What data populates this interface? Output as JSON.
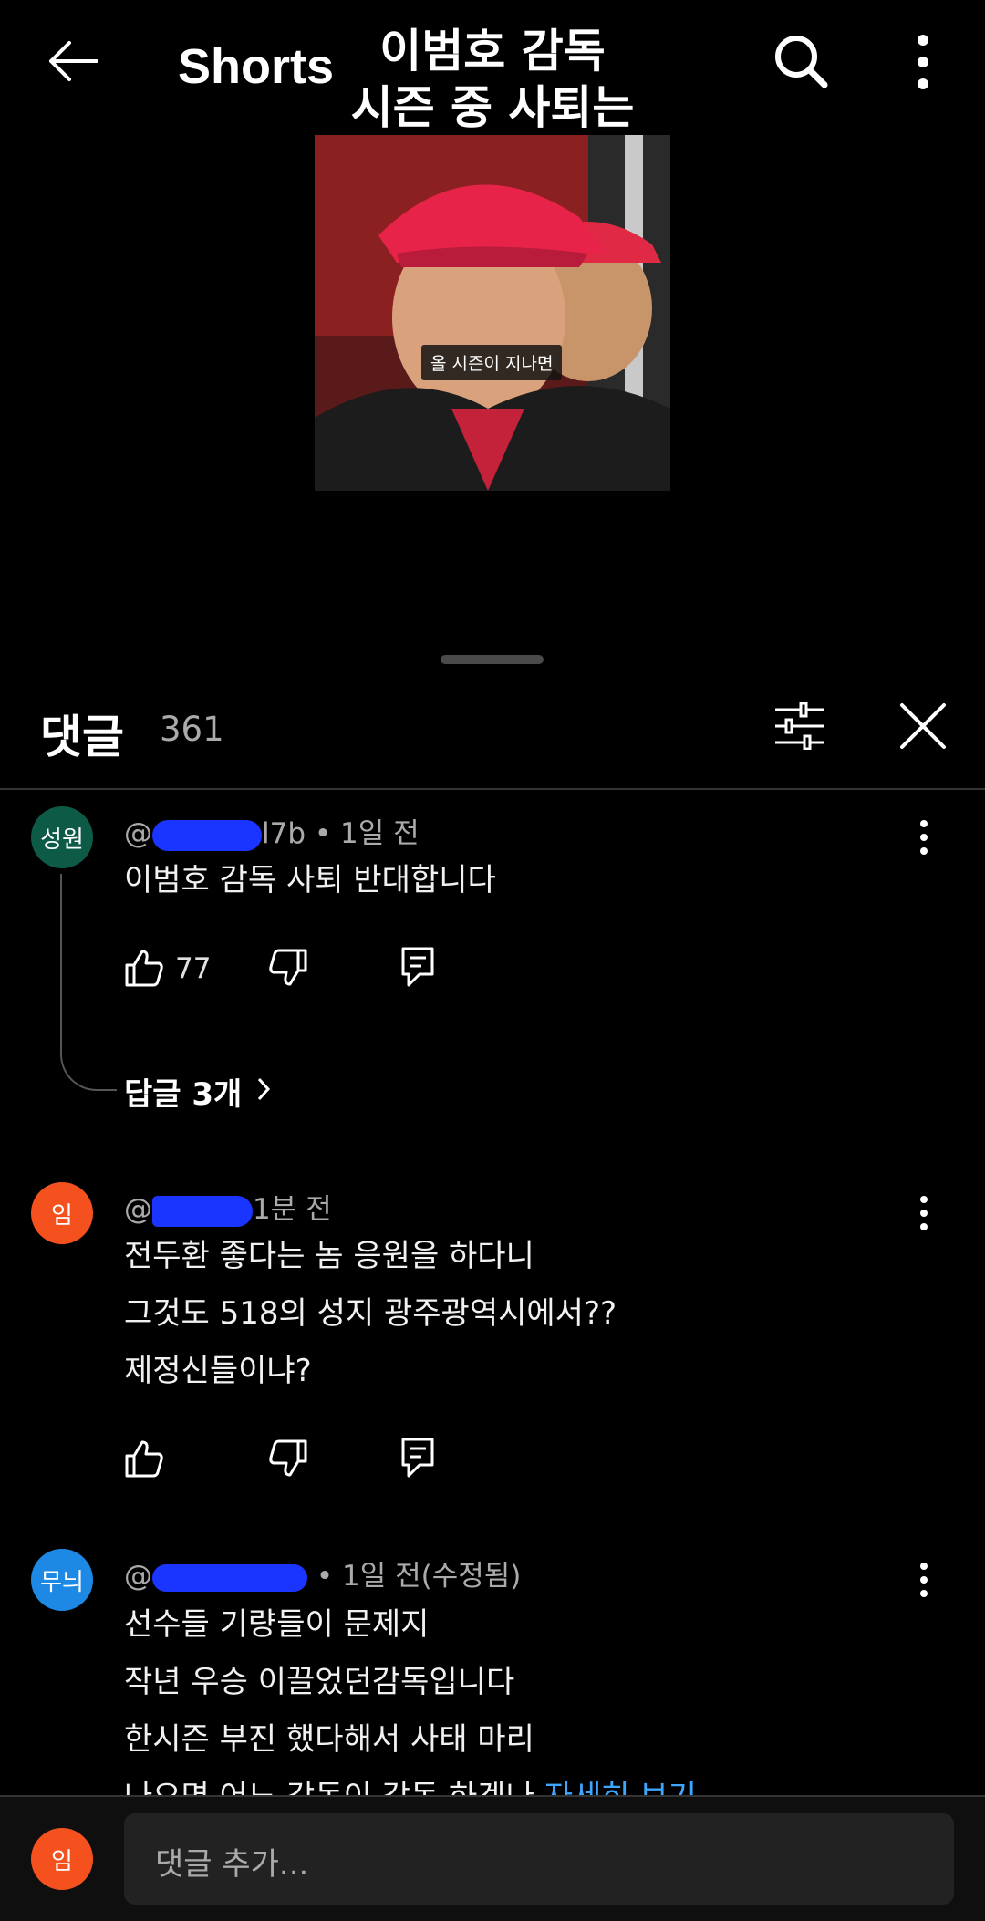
{
  "header": {
    "title": "Shorts",
    "overlay_title_line1": "이범호 감독",
    "overlay_title_line2": "시즌 중 사퇴는"
  },
  "video": {
    "caption": "올 시즌이 지나면"
  },
  "comments_panel": {
    "title": "댓글",
    "count": "361",
    "comments": [
      {
        "avatar_text": "성원",
        "avatar_color": "#0d5a47",
        "author_visible": "@",
        "author_tail": "l7b",
        "time": " • 1일 전",
        "lines": [
          "이범호 감독 사퇴 반대합니다"
        ],
        "likes": "77",
        "replies_label": "답글 3개"
      },
      {
        "avatar_text": "임",
        "avatar_color": "#f4511e",
        "author_visible": "@",
        "time": "1분 전",
        "lines": [
          "전두환 좋다는 놈 응원을 하다니",
          "그것도 518의 성지 광주광역시에서??",
          "제정신들이냐?"
        ]
      },
      {
        "avatar_text": "무늬",
        "avatar_color": "#1e88e5",
        "author_visible": "@",
        "time": " • 1일 전(수정됨)",
        "lines": [
          "선수들 기량들이 문제지",
          "작년 우승 이끌었던감독입니다",
          "한시즌 부진 했다해서 사태 마리",
          "나오면 어느 감독이 감독 하겠나"
        ],
        "read_more": "자세히 보기"
      }
    ]
  },
  "composer": {
    "avatar_text": "임",
    "avatar_color": "#f4511e",
    "placeholder": "댓글 추가..."
  },
  "icons": [
    "back-arrow-icon",
    "search-icon",
    "more-vert-icon",
    "filter-icon",
    "close-icon",
    "thumb-up-icon",
    "thumb-down-icon",
    "reply-icon",
    "chevron-right-icon"
  ]
}
